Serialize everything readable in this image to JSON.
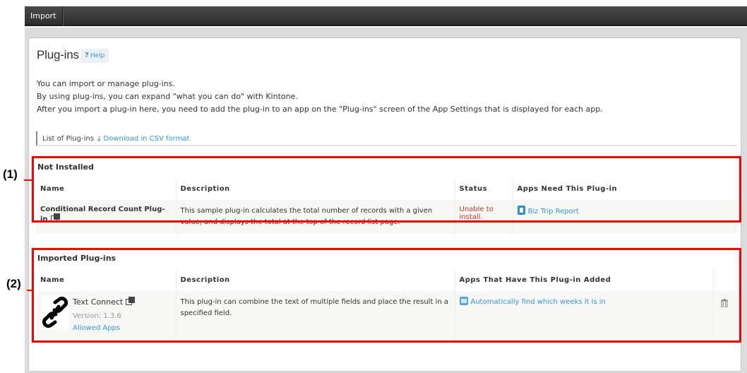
{
  "topbar": {
    "tabs": [
      {
        "label": "Import"
      }
    ]
  },
  "page": {
    "title": "Plug-ins",
    "help_label": "Help",
    "help_icon": "question-icon",
    "intro": [
      "You can import or manage plug-ins.",
      "By using plug-ins, you can expand \"what you can do\" with Kintone.",
      "After you import a plug-in here, you need to add the plug-in to an app on the \"Plug-ins\" screen of the App Settings that is displayed for each app."
    ],
    "list_label": "List of Plug-ins",
    "download_icon": "download-icon",
    "download_label": "Download in CSV format"
  },
  "not_installed": {
    "title": "Not Installed",
    "columns": [
      "Name",
      "Description",
      "Status",
      "Apps Need This Plug-in"
    ],
    "rows": [
      {
        "name": "Conditional Record Count Plug-in",
        "name_icon": "copy-icon",
        "description": "This sample plug-in calculates the total number of records with a given value, and displays the total at the top of the record list page.",
        "status": "Unable to install.",
        "app_icon": "app-icon",
        "app": "Biz Trip Report"
      }
    ]
  },
  "imported": {
    "title": "Imported Plug-ins",
    "columns": [
      "Name",
      "Description",
      "Apps That Have This Plug-in Added",
      ""
    ],
    "rows": [
      {
        "logo_icon": "link-chain-icon",
        "name": "Text Connect",
        "name_icon": "copy-icon",
        "version": "Version: 1.3.6",
        "allowed_apps": "Allowed Apps",
        "description": "This plug-in can combine the text of multiple fields and place the result in a specified field.",
        "app_icon": "app-icon",
        "app": "Automatically find which weeks it is in",
        "delete_icon": "trash-icon"
      }
    ]
  },
  "annotations": [
    {
      "label": "(1)"
    },
    {
      "label": "(2)"
    }
  ],
  "colors": {
    "annotation_box": "#ff0000",
    "link": "#3498db",
    "error": "#c0392b",
    "topbar": "#3a3a3a"
  }
}
